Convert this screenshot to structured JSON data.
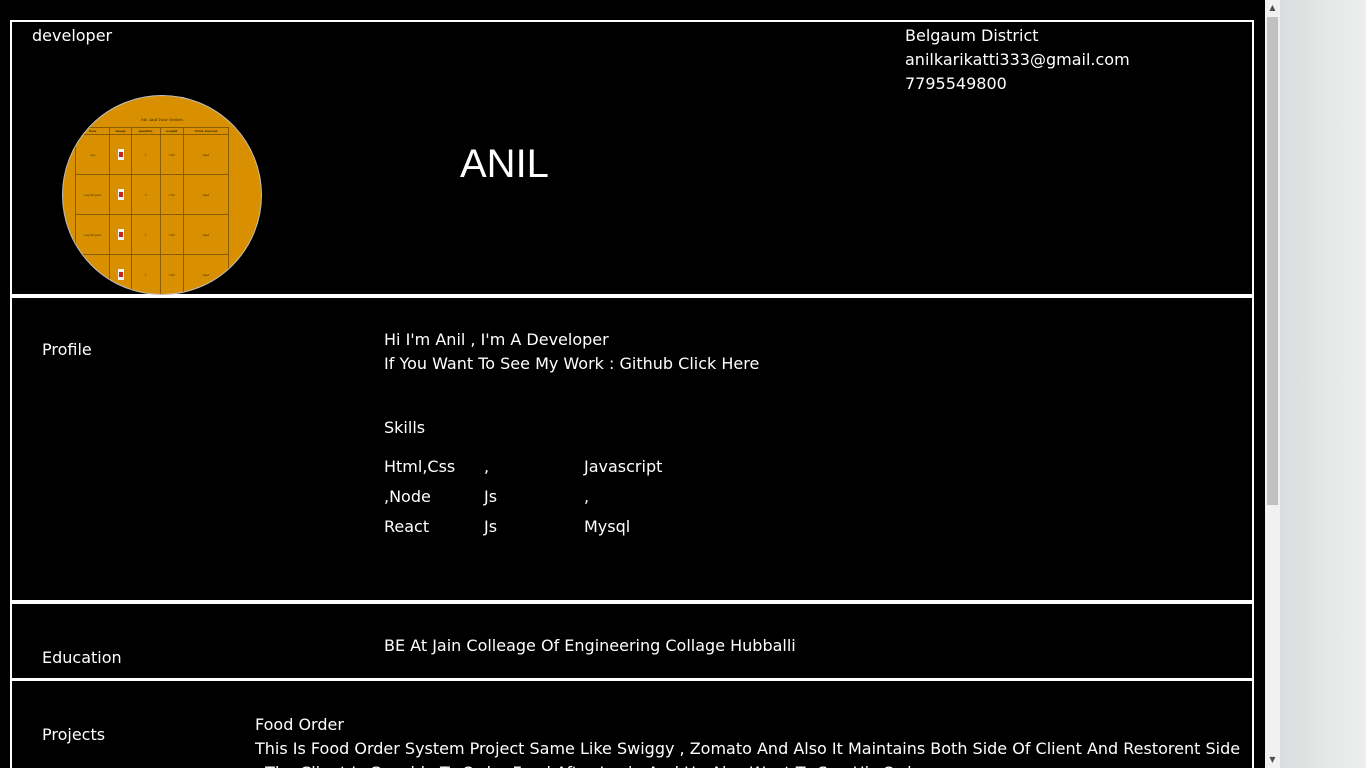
{
  "header": {
    "role": "developer",
    "name": "ANIL",
    "location": "Belgaum District",
    "email": "anilkarikatti333@gmail.com",
    "phone": "7795549800",
    "avatar": {
      "title": "Mr. Anil Your Orders",
      "columns": [
        "item",
        "image",
        "quantity",
        "weight",
        "Total Amount"
      ],
      "rows": [
        [
          "veg",
          "",
          "1",
          "100",
          "paid"
        ],
        [
          "veg biryani",
          "",
          "2",
          "150",
          "paid"
        ],
        [
          "veg biryani",
          "",
          "1",
          "100",
          "paid"
        ],
        [
          "veg",
          "",
          "1",
          "100",
          "paid"
        ]
      ]
    }
  },
  "profile": {
    "label": "Profile",
    "intro": "Hi I'm Anil , I'm A Developer",
    "work": "If You Want To See My Work : Github Click Here",
    "skills_title": "Skills",
    "skills": [
      "Html,Css",
      ",",
      "Javascript",
      ",Node",
      "Js",
      ",",
      "React",
      "Js",
      "Mysql"
    ]
  },
  "education": {
    "label": "Education",
    "text": "BE At Jain Colleage Of Engineering Collage Hubballi"
  },
  "projects": {
    "label": "Projects",
    "title": "Food Order",
    "description": "This Is Food Order System Project Same Like Swiggy , Zomato And Also It Maintains Both Side Of Client And Restorent Side . The Client Is Capable To Order Food After Login And He Also Want To See His Order"
  },
  "scrollbar": {
    "up": "▲",
    "down": "▼"
  }
}
